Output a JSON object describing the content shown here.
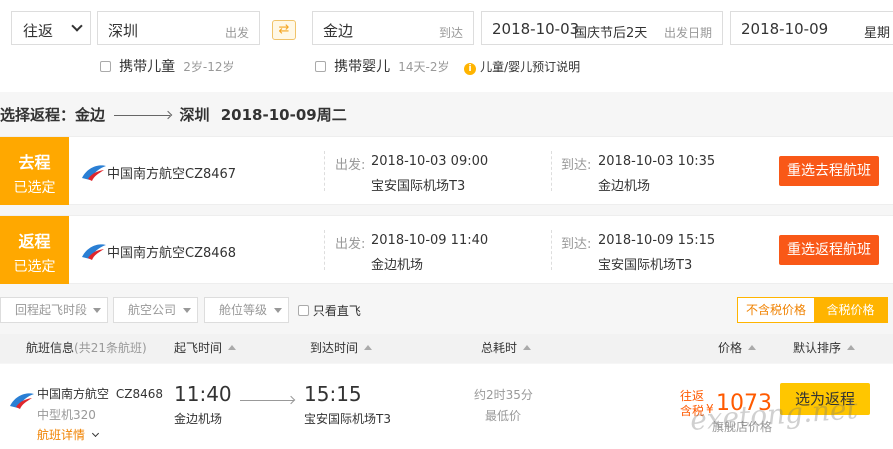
{
  "search": {
    "trip_type": "往返",
    "from_city": "深圳",
    "from_hint": "出发",
    "to_city": "金边",
    "to_hint": "到达",
    "depart_date": "2018-10-03",
    "depart_note": "国庆节后2天",
    "depart_hint": "出发日期",
    "return_date": "2018-10-09",
    "return_hint_cut": "星期",
    "with_child": "携带儿童",
    "child_age": "2岁-12岁",
    "with_infant": "携带婴儿",
    "infant_age": "14天-2岁",
    "booking_note": "儿童/婴儿预订说明",
    "info_icon_text": "i"
  },
  "selection": {
    "prefix": "选择返程：",
    "from": "金边",
    "to": "深圳",
    "date": "2018-10-09周二"
  },
  "outbound": {
    "tag_title": "去程",
    "tag_sub": "已选定",
    "airline": "中国南方航空",
    "flight_no": "CZ8467",
    "depart_label": "出发:",
    "depart_time": "2018-10-03 09:00",
    "depart_airport": "宝安国际机场T3",
    "arrive_label": "到达:",
    "arrive_time": "2018-10-03 10:35",
    "arrive_airport": "金边机场",
    "reselect": "重选去程航班"
  },
  "inbound": {
    "tag_title": "返程",
    "tag_sub": "已选定",
    "airline": "中国南方航空",
    "flight_no": "CZ8468",
    "depart_label": "出发:",
    "depart_time": "2018-10-09 11:40",
    "depart_airport": "金边机场",
    "arrive_label": "到达:",
    "arrive_time": "2018-10-09 15:15",
    "arrive_airport": "宝安国际机场T3",
    "reselect": "重选返程航班"
  },
  "filters": {
    "return_time": "回程起飞时段",
    "airline": "航空公司",
    "cabin": "舱位等级",
    "direct_only": "只看直飞",
    "price_excl_tax": "不含税价格",
    "price_incl_tax": "含税价格"
  },
  "columns": {
    "flight_info": "航班信息",
    "flight_count": "(共21条航班)",
    "depart_time": "起飞时间",
    "arrive_time": "到达时间",
    "duration": "总耗时",
    "price": "价格",
    "sort": "默认排序"
  },
  "flights": [
    {
      "airline": "中国南方航空",
      "flight_no": "CZ8468",
      "aircraft": "中型机320",
      "details": "航班详情",
      "depart_time": "11:40",
      "depart_airport": "金边机场",
      "arrive_time": "15:15",
      "arrive_airport": "宝安国际机场T3",
      "duration": "约2时35分",
      "duration_note": "最低价",
      "price_label_1": "往返",
      "price_label_2": "含税",
      "currency": "¥",
      "price": "1073",
      "price_note": "旗舰店价格",
      "select": "选为返程"
    }
  ],
  "watermark": "exetong.net",
  "colors": {
    "accent_orange": "#f95817",
    "tag_yellow": "#ffa800",
    "select_yellow": "#ffc600",
    "price_red": "#ff5a00"
  }
}
